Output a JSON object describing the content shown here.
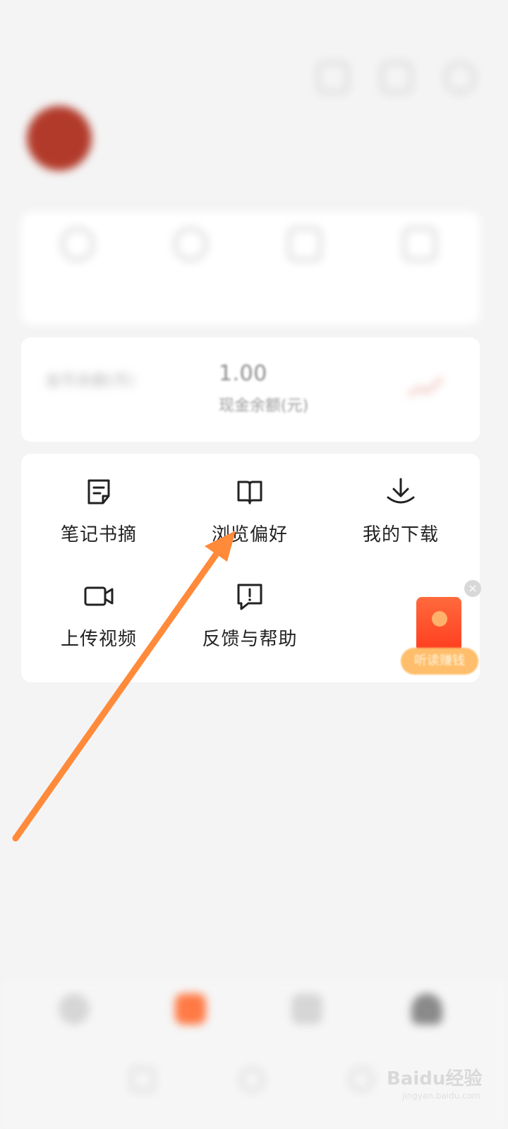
{
  "status_bar": {
    "time": "",
    "right": ""
  },
  "profile": {
    "nickname": ""
  },
  "quick_actions": [
    {
      "label": "",
      "icon": "clock-icon"
    },
    {
      "label": "",
      "icon": "heart-icon"
    },
    {
      "label": "",
      "icon": "calendar-icon"
    },
    {
      "label": "",
      "icon": "bookshelf-icon"
    }
  ],
  "balance": {
    "coin_value": "",
    "coin_label": "金币余额(币)",
    "cash_value": "1.00",
    "cash_label": "现金余额(元)"
  },
  "functions": [
    {
      "label": "笔记书摘",
      "icon": "note-icon"
    },
    {
      "label": "浏览偏好",
      "icon": "book-icon"
    },
    {
      "label": "我的下载",
      "icon": "download-icon"
    },
    {
      "label": "上传视频",
      "icon": "video-camera-icon"
    },
    {
      "label": "反馈与帮助",
      "icon": "feedback-icon"
    }
  ],
  "red_packet": {
    "label": "听读赚钱",
    "close": "×"
  },
  "bottom_nav": [
    {
      "label": "",
      "icon": "home-icon"
    },
    {
      "label": "",
      "icon": "video-icon"
    },
    {
      "label": "",
      "icon": "star-icon"
    },
    {
      "label": "",
      "icon": "person-icon"
    }
  ],
  "watermark": {
    "text": "Baidu经验",
    "sub": "jingyan.baidu.com"
  },
  "colors": {
    "accent": "#ff7a45",
    "arrow": "#ff8a3a",
    "background": "#f4f4f4",
    "card": "#ffffff"
  }
}
